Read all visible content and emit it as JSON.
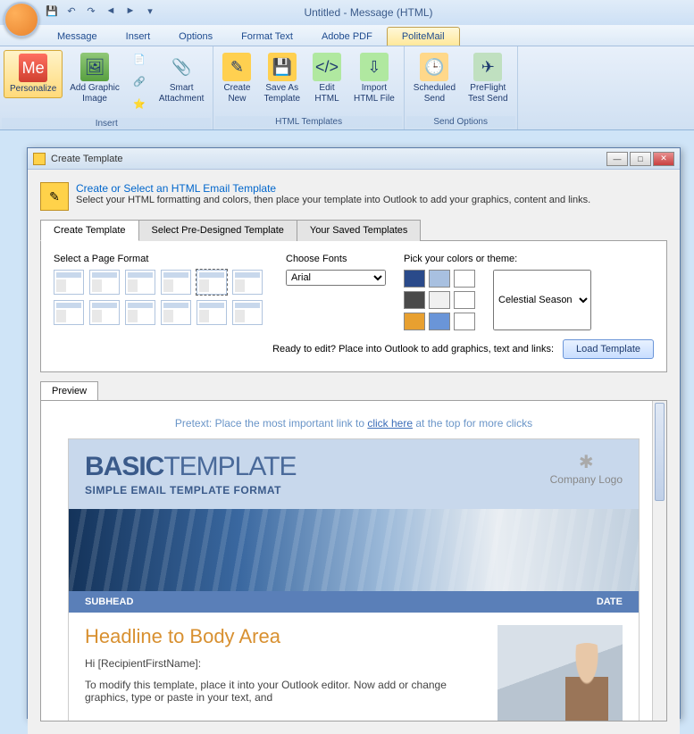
{
  "title": "Untitled - Message (HTML)",
  "tabs": [
    "Message",
    "Insert",
    "Options",
    "Format Text",
    "Adobe PDF",
    "PoliteMail"
  ],
  "active_tab": "PoliteMail",
  "ribbon": {
    "groups": [
      {
        "label": "Insert",
        "items": [
          {
            "name": "personalize",
            "label": "Personalize"
          },
          {
            "name": "add-graphic",
            "label": "Add Graphic\nImage"
          },
          {
            "name": "smart-attach",
            "label": "Smart\nAttachment"
          }
        ]
      },
      {
        "label": "HTML Templates",
        "items": [
          {
            "name": "create-new",
            "label": "Create\nNew"
          },
          {
            "name": "save-as",
            "label": "Save As\nTemplate"
          },
          {
            "name": "edit-html",
            "label": "Edit\nHTML"
          },
          {
            "name": "import-html",
            "label": "Import\nHTML File"
          }
        ]
      },
      {
        "label": "Send Options",
        "items": [
          {
            "name": "scheduled",
            "label": "Scheduled\nSend"
          },
          {
            "name": "preflight",
            "label": "PreFlight\nTest Send"
          }
        ]
      }
    ]
  },
  "dialog": {
    "title": "Create Template",
    "heading": "Create or Select an HTML Email Template",
    "desc": "Select your HTML formatting and colors, then place your template into Outlook to add your graphics, content and links.",
    "tabs": [
      "Create Template",
      "Select Pre-Designed Template",
      "Your Saved Templates"
    ],
    "labels": {
      "format": "Select a Page Format",
      "fonts": "Choose Fonts",
      "colors": "Pick your colors or theme:"
    },
    "font": "Arial",
    "theme": "Celestial Season",
    "swatches": [
      "#2a4a8a",
      "#a8c0e0",
      "#ffffff",
      "#4a4a4a",
      "#f0f0f0",
      "#ffffff",
      "#e8a030",
      "#6a95d8",
      "#ffffff"
    ],
    "ready_text": "Ready to edit? Place into Outlook to add graphics, text and links:",
    "load_btn": "Load Template",
    "preview_tab": "Preview"
  },
  "preview": {
    "pretext_a": "Pretext: Place the most important link to ",
    "pretext_link": "click here",
    "pretext_b": " at the top for more clicks",
    "title_bold": "BASIC",
    "title_light": "TEMPLATE",
    "subtitle": "SIMPLE EMAIL TEMPLATE FORMAT",
    "logo": "Company Logo",
    "subhead": "SUBHEAD",
    "date": "DATE",
    "headline": "Headline to Body Area",
    "greeting": "Hi [RecipientFirstName]:",
    "body": "To modify this template, place it into your Outlook editor. Now add or change graphics, type or paste in your text, and"
  }
}
